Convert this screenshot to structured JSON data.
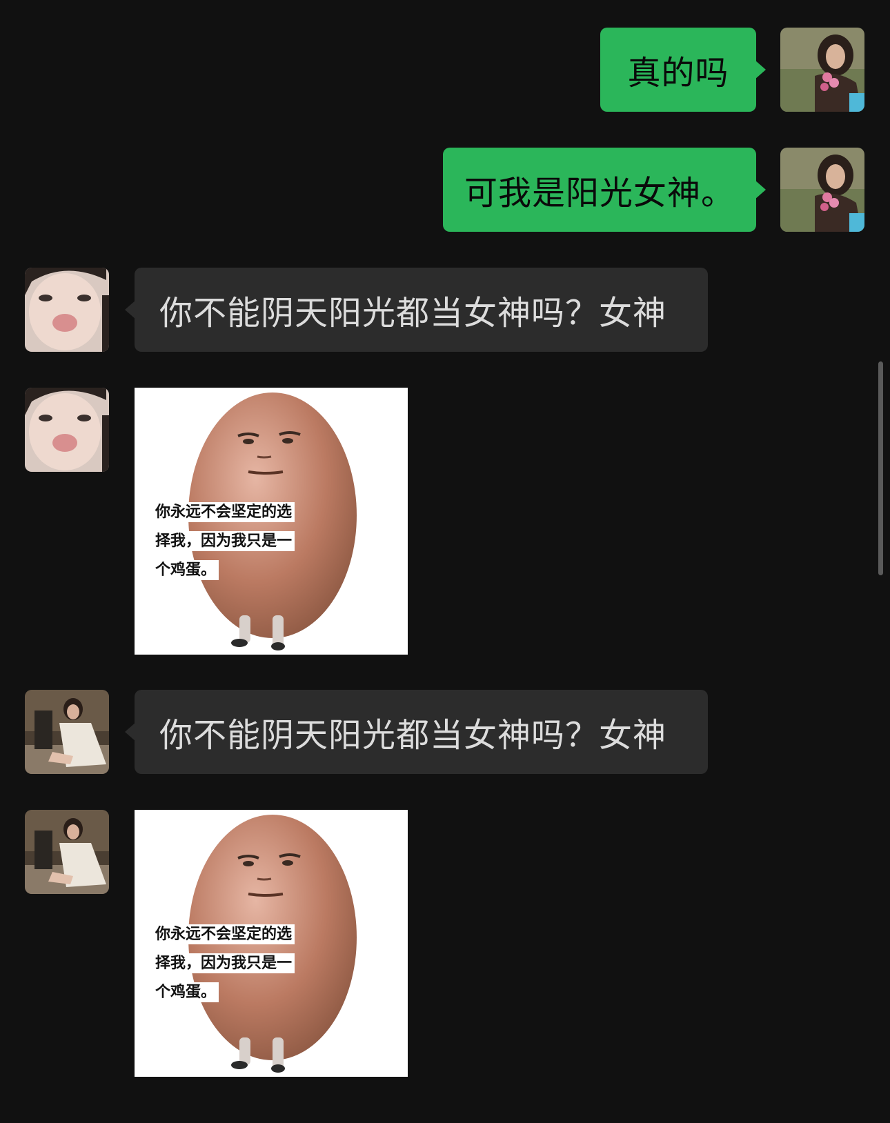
{
  "messages": [
    {
      "side": "me",
      "type": "text",
      "text": "真的吗"
    },
    {
      "side": "me",
      "type": "text",
      "text": "可我是阳光女神。"
    },
    {
      "side": "them",
      "type": "text",
      "text": "你不能阴天阳光都当女神吗？女神"
    },
    {
      "side": "them",
      "type": "sticker",
      "caption_lines": [
        "你永远不会坚定的选",
        "择我，因为我只是一",
        "个鸡蛋。"
      ]
    },
    {
      "side": "them2",
      "type": "text",
      "text": "你不能阴天阳光都当女神吗？女神"
    },
    {
      "side": "them2",
      "type": "sticker",
      "caption_lines": [
        "你永远不会坚定的选",
        "择我，因为我只是一",
        "个鸡蛋。"
      ]
    }
  ],
  "colors": {
    "background": "#111111",
    "my_bubble": "#2bb65a",
    "their_bubble": "#2c2c2c"
  },
  "icons": {
    "my_avatar": "woman-with-flowers-avatar",
    "their_avatar_1": "child-pout-avatar",
    "their_avatar_2": "woman-sitting-avatar"
  }
}
